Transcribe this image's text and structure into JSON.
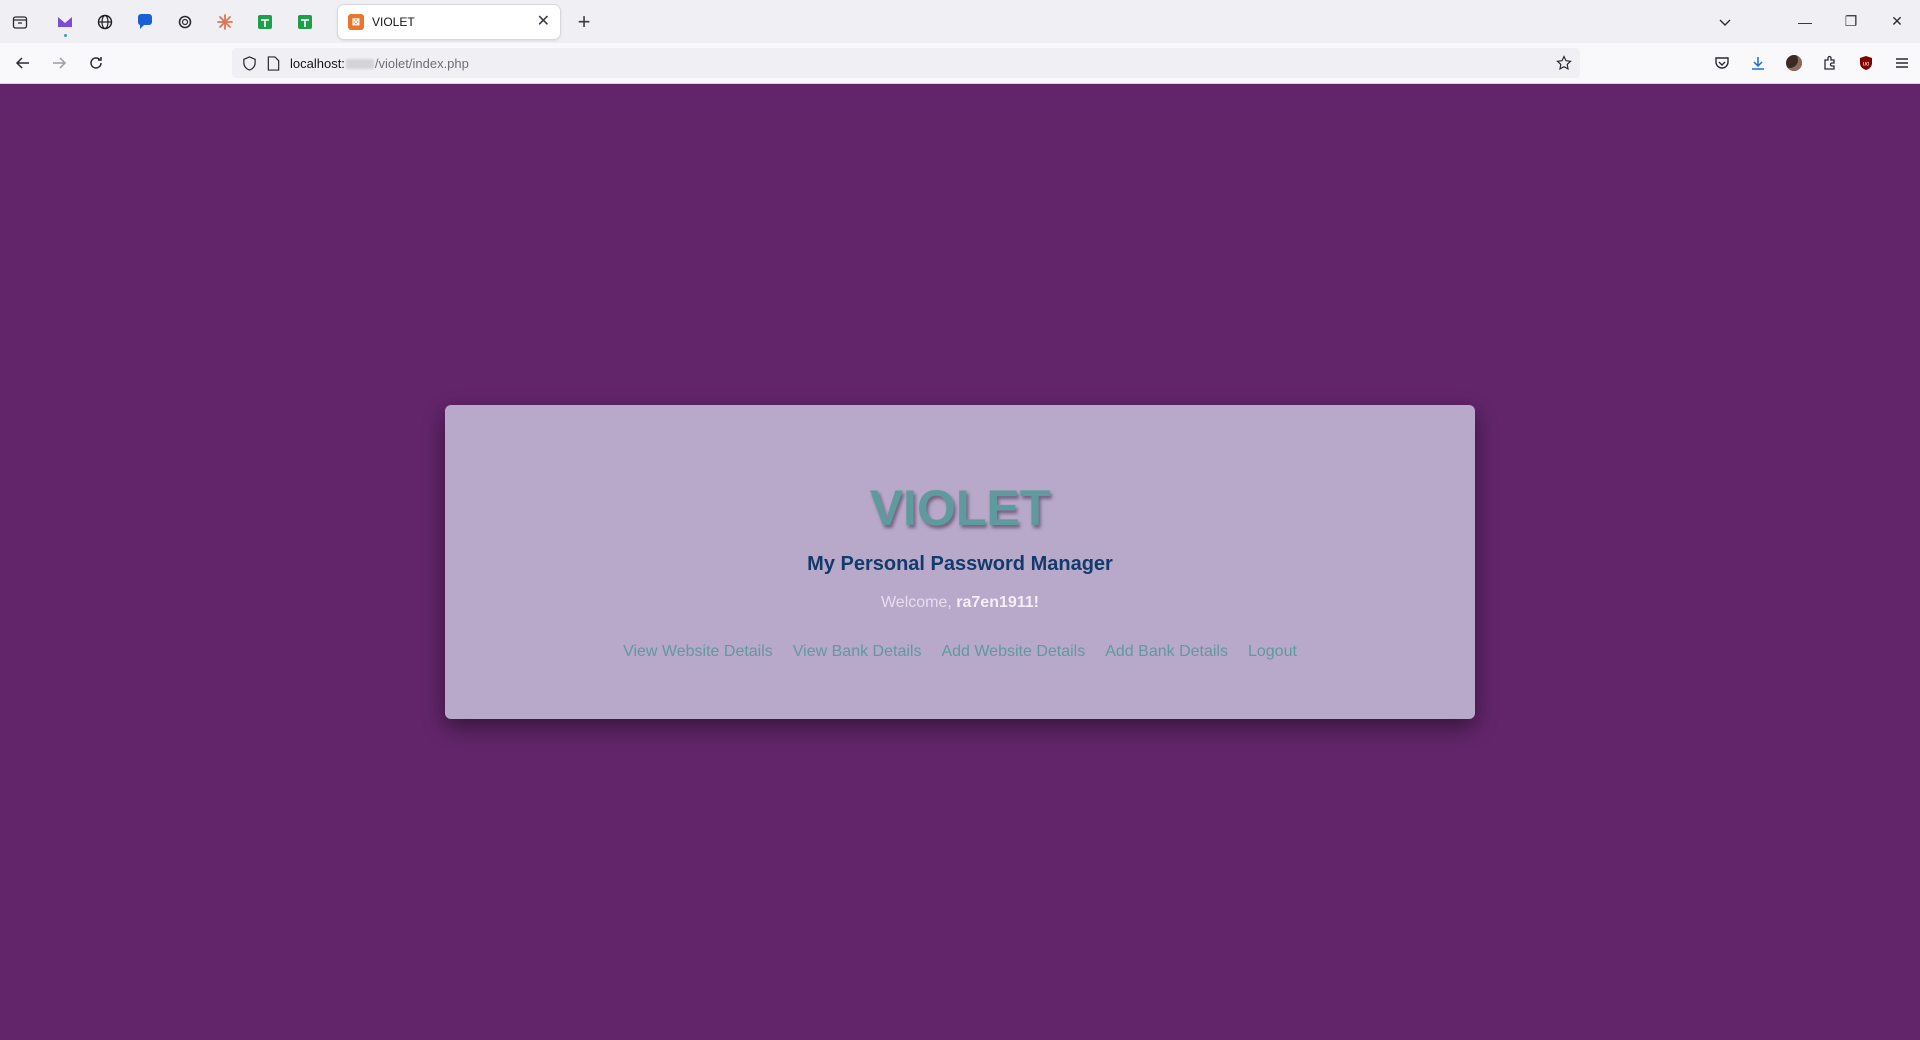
{
  "browser": {
    "pinned_tabs": [
      "tab-groups-icon",
      "pinned-tab-purple-m-icon",
      "pinned-tab-globe-icon",
      "pinned-tab-chat-bubble-icon",
      "pinned-tab-openai-icon",
      "pinned-tab-claude-icon",
      "pinned-tab-sheets-icon",
      "pinned-tab-sheets-icon"
    ],
    "active_tab": {
      "title": "VIOLET",
      "favicon": "xampp-icon"
    },
    "url": {
      "host": "localhost:",
      "path": "/violet/index.php"
    }
  },
  "page": {
    "logo": "VIOLET",
    "subtitle": "My Personal Password Manager",
    "welcome_prefix": "Welcome, ",
    "username": "ra7en1911!",
    "links": [
      "View Website Details",
      "View Bank Details",
      "Add Website Details",
      "Add Bank Details",
      "Logout"
    ]
  },
  "colors": {
    "background": "#62256a",
    "card": "#b8a8c9",
    "logo": "#5f9a9e",
    "subtitle": "#123b6b",
    "link": "#5f9a9e"
  }
}
